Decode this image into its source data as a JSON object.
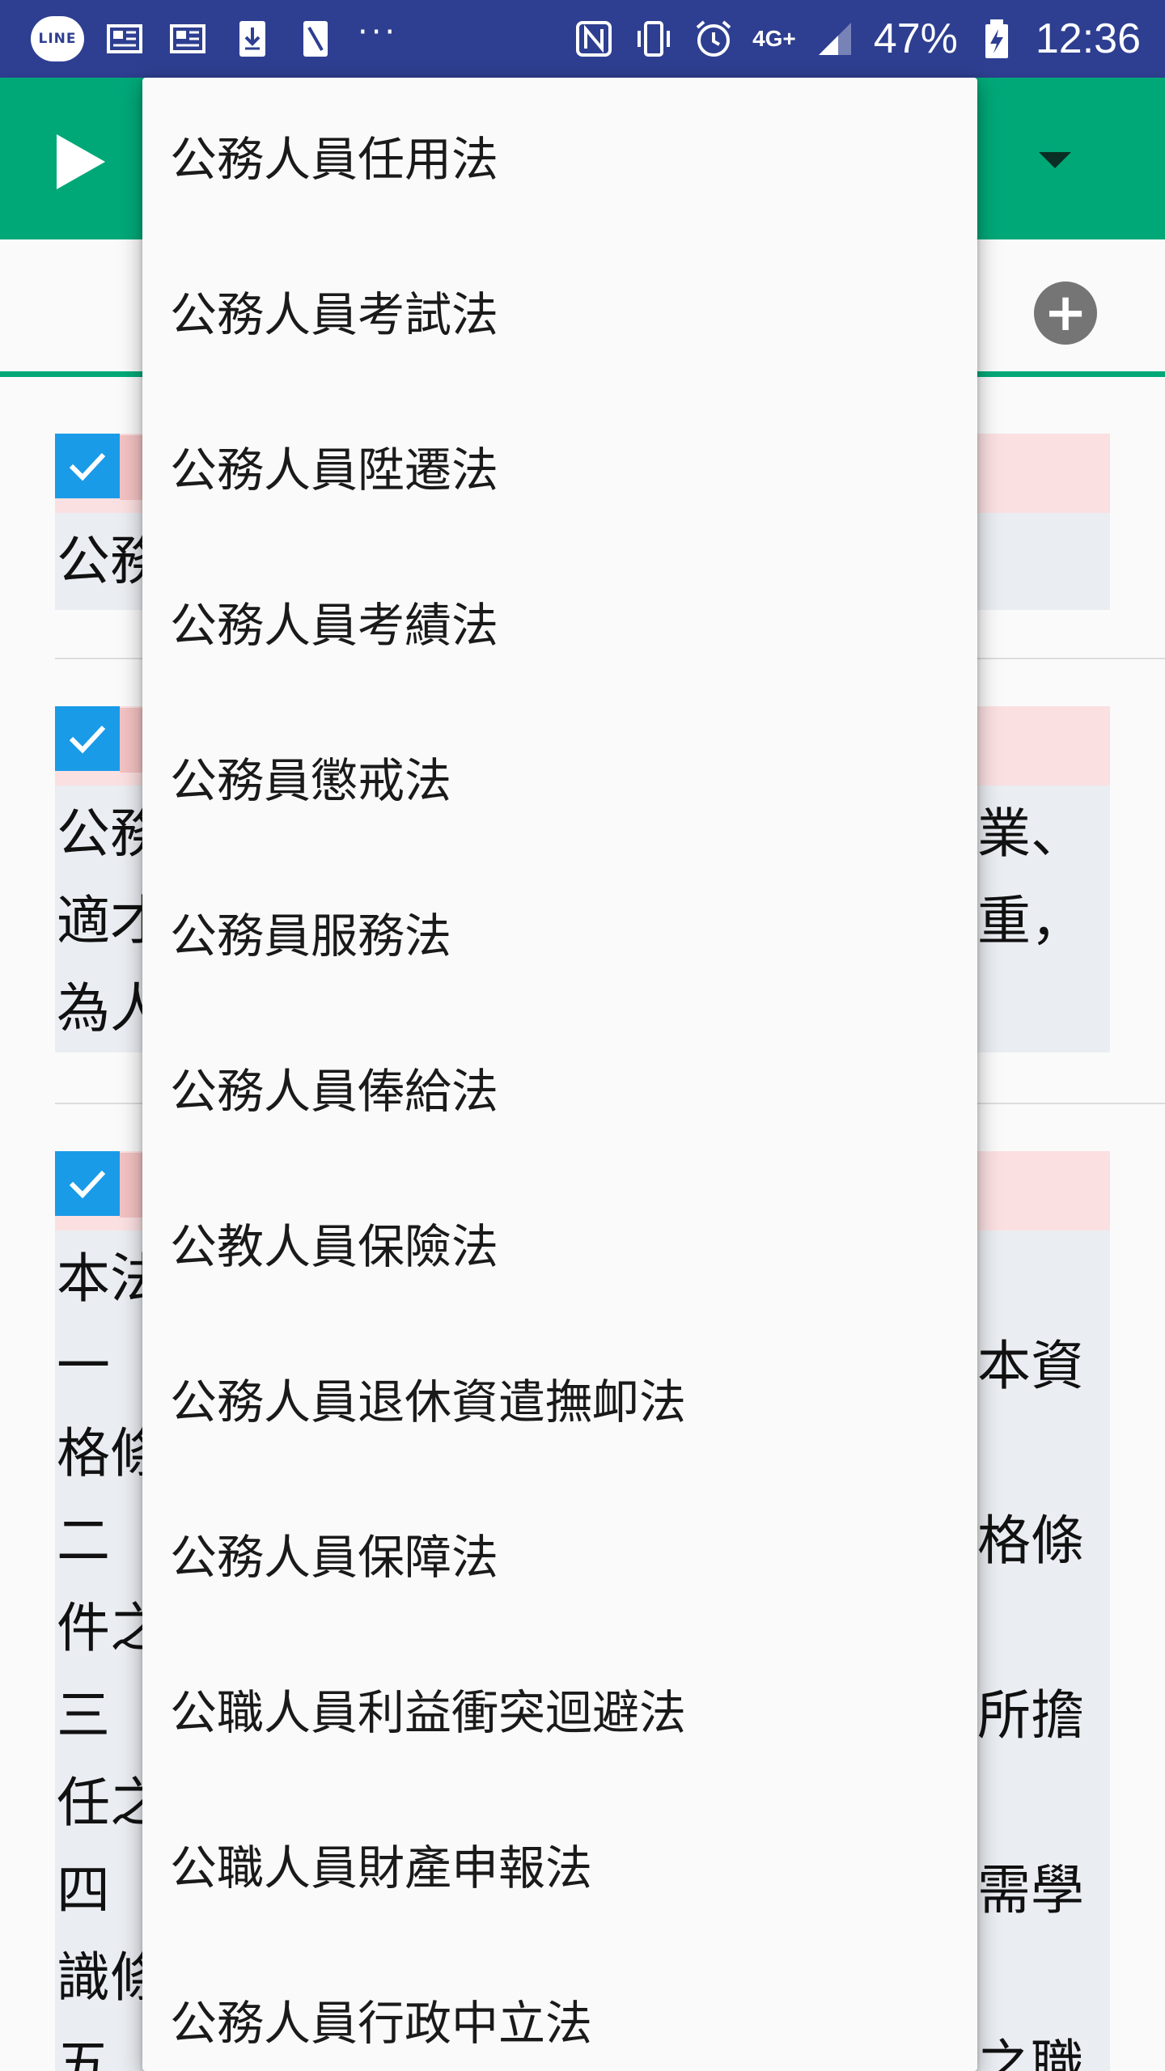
{
  "status_bar": {
    "line_badge": "LINE",
    "dots": "···",
    "nfc": "N",
    "network": "4G+",
    "battery": "47%",
    "time": "12:36"
  },
  "app_bar": {
    "background": "#00a878"
  },
  "content_cards": [
    {
      "left_lines": [
        "公務"
      ],
      "right_lines": []
    },
    {
      "left_lines": [
        "公務",
        "適才",
        "為人"
      ],
      "right_lines": [
        "業、",
        "重，",
        ""
      ]
    },
    {
      "left_lines": [
        "本法",
        "一",
        "格條",
        "二",
        "件之",
        "三",
        "任之",
        "四",
        "識條",
        "五"
      ],
      "right_lines": [
        "",
        "本資",
        "",
        "格條",
        "",
        "所擔",
        "",
        "需學",
        "",
        "之職"
      ]
    }
  ],
  "menu": {
    "items": [
      "公務人員任用法",
      "公務人員考試法",
      "公務人員陞遷法",
      "公務人員考績法",
      "公務員懲戒法",
      "公務員服務法",
      "公務人員俸給法",
      "公教人員保險法",
      "公務人員退休資遣撫卹法",
      "公務人員保障法",
      "公職人員利益衝突迴避法",
      "公職人員財產申報法",
      "公務人員行政中立法"
    ]
  }
}
